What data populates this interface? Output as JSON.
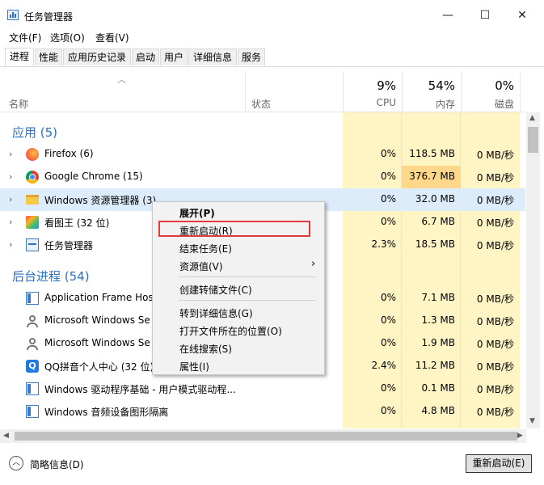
{
  "window": {
    "title": "任务管理器",
    "minimize": "—",
    "maximize": "☐",
    "close": "✕"
  },
  "menu": [
    "文件(F)",
    "选项(O)",
    "查看(V)"
  ],
  "tabs": [
    "进程",
    "性能",
    "应用历史记录",
    "启动",
    "用户",
    "详细信息",
    "服务"
  ],
  "columns": {
    "name": "名称",
    "status": "状态",
    "cpu_pct": "9%",
    "cpu": "CPU",
    "mem_pct": "54%",
    "mem": "内存",
    "disk_pct": "0%",
    "disk": "磁盘"
  },
  "sections": {
    "apps": "应用 (5)",
    "background": "后台进程 (54)"
  },
  "apps": [
    {
      "name": "Firefox (6)",
      "icon": "firefox-icon",
      "cpu": "0%",
      "mem": "118.5 MB",
      "disk": "0 MB/秒"
    },
    {
      "name": "Google Chrome (15)",
      "icon": "chrome-icon",
      "cpu": "0%",
      "mem": "376.7 MB",
      "disk": "0 MB/秒"
    },
    {
      "name": "Windows 资源管理器 (3)",
      "icon": "folder-icon",
      "cpu": "0%",
      "mem": "32.0 MB",
      "disk": "0 MB/秒"
    },
    {
      "name": "看图王 (32 位)",
      "icon": "image-viewer-icon",
      "cpu": "0%",
      "mem": "6.7 MB",
      "disk": "0 MB/秒"
    },
    {
      "name": "任务管理器",
      "icon": "task-manager-icon",
      "cpu": "2.3%",
      "mem": "18.5 MB",
      "disk": "0 MB/秒"
    }
  ],
  "background": [
    {
      "name": "Application Frame Hos",
      "icon": "app-frame-icon",
      "cpu": "0%",
      "mem": "7.1 MB",
      "disk": "0 MB/秒"
    },
    {
      "name": "Microsoft Windows Se",
      "icon": "user-service-icon",
      "cpu": "0%",
      "mem": "1.3 MB",
      "disk": "0 MB/秒"
    },
    {
      "name": "Microsoft Windows Se",
      "icon": "user-service-icon",
      "cpu": "0%",
      "mem": "1.9 MB",
      "disk": "0 MB/秒"
    },
    {
      "name": "QQ拼音个人中心 (32 位)",
      "icon": "qq-pinyin-icon",
      "cpu": "2.4%",
      "mem": "11.2 MB",
      "disk": "0 MB/秒"
    },
    {
      "name": "Windows 驱动程序基础 - 用户模式驱动程...",
      "icon": "driver-icon",
      "cpu": "0%",
      "mem": "0.1 MB",
      "disk": "0 MB/秒"
    },
    {
      "name": "Windows 音频设备图形隔离",
      "icon": "audio-icon",
      "cpu": "0%",
      "mem": "4.8 MB",
      "disk": "0 MB/秒"
    }
  ],
  "context_menu": {
    "expand": "展开(P)",
    "restart": "重新启动(R)",
    "end_task": "结束任务(E)",
    "resource_values": "资源值(V)",
    "create_dump": "创建转储文件(C)",
    "go_to_details": "转到详细信息(G)",
    "open_file_location": "打开文件所在的位置(O)",
    "search_online": "在线搜索(S)",
    "properties": "属性(I)"
  },
  "footer": {
    "fewer_details": "简略信息(D)",
    "restart_button": "重新启动(E)"
  },
  "colors": {
    "accent": "#2c6fbf",
    "heat_light": "#fff4c4",
    "heat_high": "#ffd78a",
    "selection": "#dcecfb",
    "highlight_box": "#e23b3b"
  }
}
